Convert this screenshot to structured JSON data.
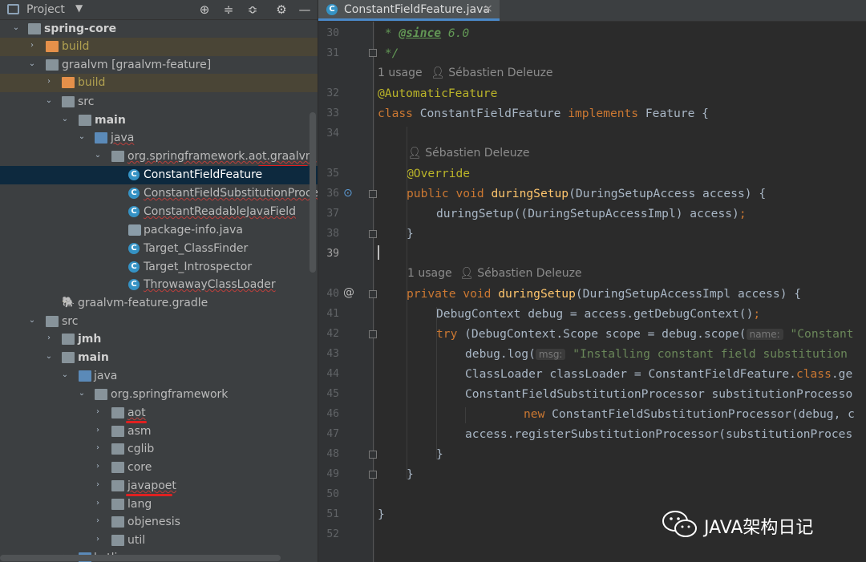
{
  "project_panel": {
    "title": "Project",
    "dropdown_icon": "chevron-down-icon",
    "toolbar_icons": [
      "target-icon",
      "expand-all-icon",
      "collapse-all-icon",
      "gear-icon",
      "minimize-icon"
    ],
    "tree": [
      {
        "label": "spring-core",
        "bold": true
      },
      {
        "label": "build"
      },
      {
        "label": "graalvm [graalvm-feature]"
      },
      {
        "label": "build"
      },
      {
        "label": "src"
      },
      {
        "label": "main",
        "bold": true
      },
      {
        "label": "java"
      },
      {
        "label": "org.springframework.aot.graalvm"
      },
      {
        "label": "ConstantFieldFeature"
      },
      {
        "label": "ConstantFieldSubstitutionProcessor"
      },
      {
        "label": "ConstantReadableJavaField"
      },
      {
        "label": "package-info.java"
      },
      {
        "label": "Target_ClassFinder"
      },
      {
        "label": "Target_Introspector"
      },
      {
        "label": "ThrowawayClassLoader"
      },
      {
        "label": "graalvm-feature.gradle"
      },
      {
        "label": "src"
      },
      {
        "label": "jmh",
        "bold": true
      },
      {
        "label": "main",
        "bold": true
      },
      {
        "label": "java"
      },
      {
        "label": "org.springframework"
      },
      {
        "label": "aot"
      },
      {
        "label": "asm"
      },
      {
        "label": "cglib"
      },
      {
        "label": "core"
      },
      {
        "label": "javapoet"
      },
      {
        "label": "lang"
      },
      {
        "label": "objenesis"
      },
      {
        "label": "util"
      },
      {
        "label": "kotlin"
      }
    ]
  },
  "editor": {
    "tab_label": "ConstantFieldFeature.java",
    "tab_close": "×",
    "line_numbers": [
      "30",
      "31",
      "32",
      "33",
      "34",
      "35",
      "36",
      "37",
      "38",
      "39",
      "40",
      "41",
      "42",
      "43",
      "44",
      "45",
      "46",
      "47",
      "48",
      "49",
      "50",
      "51",
      "52"
    ],
    "usage_hint_1": "1 usage",
    "author_1": "Sébastien Deleuze",
    "author_2": "Sébastien Deleuze",
    "usage_hint_3": "1 usage",
    "author_3": "Sébastien Deleuze",
    "code": {
      "l30_a": " * ",
      "l30_tag": "@since",
      "l30_b": " 6.0",
      "l31": " */",
      "l32": "@AutomaticFeature",
      "l33_kw": "class",
      "l33_name": " ConstantFieldFeature ",
      "l33_kw2": "implements",
      "l33_rest": " Feature {",
      "l35": "@Override",
      "l36_kw": "public void ",
      "l36_fn": "duringSetup",
      "l36_rest": "(DuringSetupAccess access) {",
      "l37_a": "duringSetup((DuringSetupAccessImpl) access)",
      "l37_b": ";",
      "l38": "}",
      "l40_kw": "private void ",
      "l40_fn": "duringSetup",
      "l40_rest": "(DuringSetupAccessImpl access) {",
      "l41_a": "DebugContext debug = access.getDebugContext()",
      "l41_b": ";",
      "l42_kw": "try",
      "l42_a": " (DebugContext.Scope scope = debug.scope(",
      "l42_hint": "name:",
      "l42_str": "\"Constant",
      "l43_a": "debug.log(",
      "l43_hint": "msg:",
      "l43_str": "\"Installing constant field substitution",
      "l44_a": "ClassLoader classLoader = ConstantFieldFeature.",
      "l44_kw": "class",
      "l44_b": ".ge",
      "l45": "ConstantFieldSubstitutionProcessor substitutionProcesso",
      "l46_kw": "new",
      "l46_a": " ConstantFieldSubstitutionProcessor(debug, c",
      "l47": "access.registerSubstitutionProcessor(substitutionProces",
      "l48": "}",
      "l49": "}",
      "l51": "}"
    }
  },
  "watermark": {
    "text": "JAVA架构日记",
    "logo_icon": "wechat-icon"
  }
}
